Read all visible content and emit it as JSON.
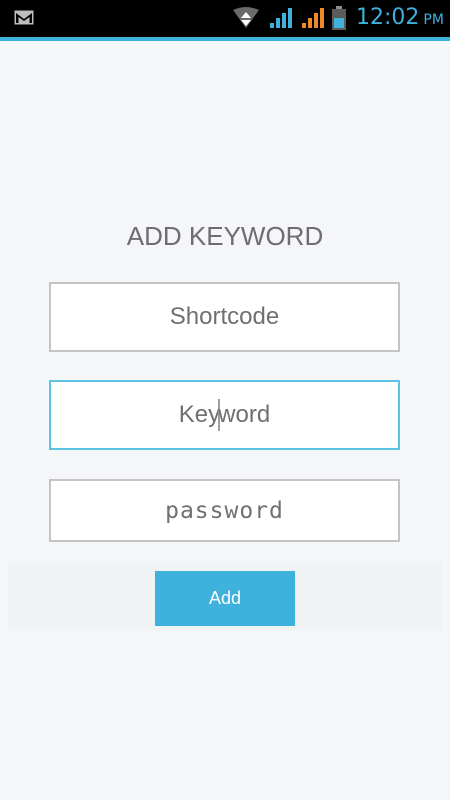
{
  "status_bar": {
    "time": "12:02",
    "ampm": "PM",
    "icons": [
      "gmail-icon",
      "data-transfer-icon",
      "signal-icon",
      "signal-icon",
      "battery-icon"
    ],
    "accent_color": "#3eb2dc"
  },
  "form": {
    "title": "ADD KEYWORD",
    "shortcode_placeholder": "Shortcode",
    "keyword_placeholder_before_caret": "Key",
    "keyword_placeholder_after_caret": "word",
    "password_placeholder": "password",
    "add_label": "Add"
  },
  "colors": {
    "button": "#3eb2dc",
    "focused_border": "#5cc3e2",
    "field_border": "#c4c4c6",
    "background": "#f5f6f8"
  }
}
